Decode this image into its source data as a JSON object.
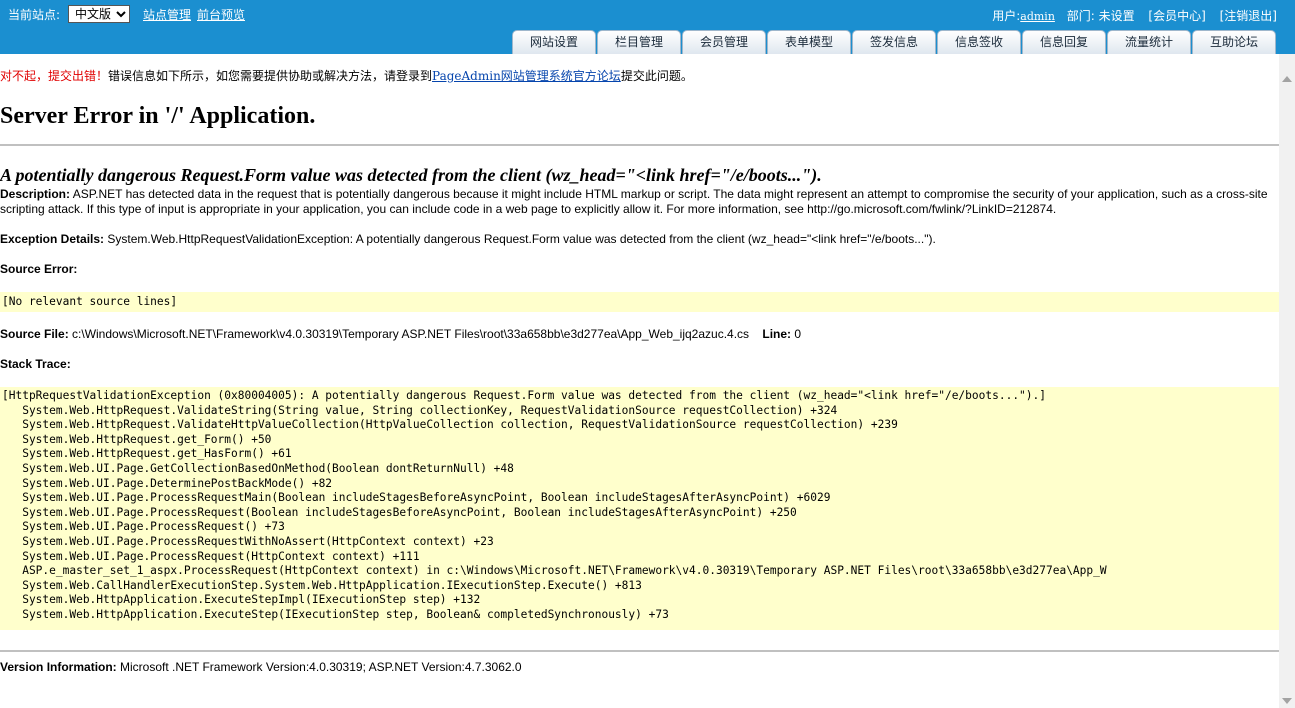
{
  "topbar": {
    "site_label": "当前站点:",
    "site_select": {
      "selected": "中文版",
      "options": [
        "中文版"
      ]
    },
    "links": [
      "站点管理",
      "前台预览"
    ],
    "user_prefix": "用户:",
    "username": "admin",
    "dept_text": "部门: 未设置",
    "member_center": "[会员中心]",
    "logout": "[注销退出]",
    "tabs": [
      "网站设置",
      "栏目管理",
      "会员管理",
      "表单模型",
      "签发信息",
      "信息签收",
      "信息回复",
      "流量统计",
      "互助论坛"
    ]
  },
  "error": {
    "notice_red": "对不起，提交出错！",
    "notice_text": "错误信息如下所示，如您需要提供协助或解决方法，请登录到",
    "notice_link": "PageAdmin网站管理系统官方论坛",
    "notice_suffix": "提交此问题。",
    "title": "Server Error in '/' Application.",
    "subtitle": "A potentially dangerous Request.Form value was detected from the client (wz_head=\"<link href=\"/e/boots...\").",
    "description_label": "Description:",
    "description_text": " ASP.NET has detected data in the request that is potentially dangerous because it might include HTML markup or script. The data might represent an attempt to compromise the security of your application, such as a cross-site scripting attack. If this type of input is appropriate in your application, you can include code in a web page to explicitly allow it. For more information, see http://go.microsoft.com/fwlink/?LinkID=212874.",
    "exception_label": "Exception Details:",
    "exception_text": " System.Web.HttpRequestValidationException: A potentially dangerous Request.Form value was detected from the client (wz_head=\"<link href=\"/e/boots...\").",
    "source_error_label": "Source Error:",
    "source_error_text": "[No relevant source lines]",
    "source_file_label": "Source File:",
    "source_file_text": " c:\\Windows\\Microsoft.NET\\Framework\\v4.0.30319\\Temporary ASP.NET Files\\root\\33a658bb\\e3d277ea\\App_Web_ijq2azuc.4.cs",
    "line_label": "Line:",
    "line_value": " 0",
    "stack_trace_label": "Stack Trace:",
    "stack_trace": [
      "[HttpRequestValidationException (0x80004005): A potentially dangerous Request.Form value was detected from the client (wz_head=\"<link href=\"/e/boots...\").]",
      "   System.Web.HttpRequest.ValidateString(String value, String collectionKey, RequestValidationSource requestCollection) +324",
      "   System.Web.HttpRequest.ValidateHttpValueCollection(HttpValueCollection collection, RequestValidationSource requestCollection) +239",
      "   System.Web.HttpRequest.get_Form() +50",
      "   System.Web.HttpRequest.get_HasForm() +61",
      "   System.Web.UI.Page.GetCollectionBasedOnMethod(Boolean dontReturnNull) +48",
      "   System.Web.UI.Page.DeterminePostBackMode() +82",
      "   System.Web.UI.Page.ProcessRequestMain(Boolean includeStagesBeforeAsyncPoint, Boolean includeStagesAfterAsyncPoint) +6029",
      "   System.Web.UI.Page.ProcessRequest(Boolean includeStagesBeforeAsyncPoint, Boolean includeStagesAfterAsyncPoint) +250",
      "   System.Web.UI.Page.ProcessRequest() +73",
      "   System.Web.UI.Page.ProcessRequestWithNoAssert(HttpContext context) +23",
      "   System.Web.UI.Page.ProcessRequest(HttpContext context) +111",
      "   ASP.e_master_set_1_aspx.ProcessRequest(HttpContext context) in c:\\Windows\\Microsoft.NET\\Framework\\v4.0.30319\\Temporary ASP.NET Files\\root\\33a658bb\\e3d277ea\\App_W",
      "   System.Web.CallHandlerExecutionStep.System.Web.HttpApplication.IExecutionStep.Execute() +813",
      "   System.Web.HttpApplication.ExecuteStepImpl(IExecutionStep step) +132",
      "   System.Web.HttpApplication.ExecuteStep(IExecutionStep step, Boolean& completedSynchronously) +73"
    ],
    "version_label": "Version Information:",
    "version_text": " Microsoft .NET Framework Version:4.0.30319; ASP.NET Version:4.7.3062.0"
  },
  "colors": {
    "topbar": "#1b8fd0",
    "code_bg": "#ffffcc",
    "notice_red": "#e00000",
    "link": "#0645ad"
  }
}
